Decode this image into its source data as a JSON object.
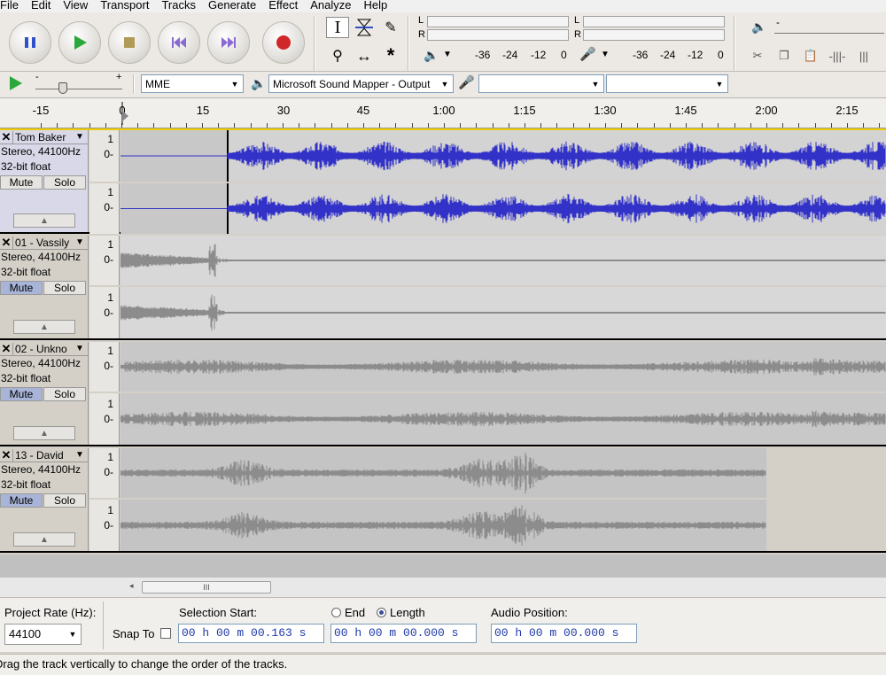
{
  "menu": [
    "File",
    "Edit",
    "View",
    "Transport",
    "Tracks",
    "Generate",
    "Effect",
    "Analyze",
    "Help"
  ],
  "transport": {
    "buttons": [
      {
        "name": "pause",
        "icon": "pause-icon"
      },
      {
        "name": "play",
        "icon": "play-icon"
      },
      {
        "name": "stop",
        "icon": "stop-icon"
      },
      {
        "name": "skip-start",
        "icon": "skip-start-icon"
      },
      {
        "name": "skip-end",
        "icon": "skip-end-icon"
      },
      {
        "name": "record",
        "icon": "record-icon"
      }
    ]
  },
  "meters": {
    "lr_labels": [
      "L",
      "R"
    ],
    "play_scale": [
      "-36",
      "-24",
      "-12",
      "0"
    ],
    "rec_scale": [
      "-36",
      "-24",
      "-12",
      "0"
    ]
  },
  "mixer": {
    "slider_minus": "-",
    "slider_plus": "+"
  },
  "device": {
    "host": "MME",
    "output": "Microsoft Sound Mapper - Output",
    "input": "",
    "channels": ""
  },
  "timeline": {
    "labels": [
      "-15",
      "0",
      "15",
      "30",
      "45",
      "1:00",
      "1:15",
      "1:30",
      "1:45",
      "2:00",
      "2:15"
    ]
  },
  "tracks": [
    {
      "name": "Tom Baker",
      "rate": "Stereo, 44100Hz",
      "format": "32-bit float",
      "mute": "Mute",
      "solo": "Solo",
      "mute_on": false,
      "selected": true,
      "scale_top": "1",
      "scale_mid": "0-"
    },
    {
      "name": "01 - Vassily",
      "rate": "Stereo, 44100Hz",
      "format": "32-bit float",
      "mute": "Mute",
      "solo": "Solo",
      "mute_on": true,
      "selected": false,
      "scale_top": "1",
      "scale_mid": "0-"
    },
    {
      "name": "02 - Unkno",
      "rate": "Stereo, 44100Hz",
      "format": "32-bit float",
      "mute": "Mute",
      "solo": "Solo",
      "mute_on": true,
      "selected": false,
      "scale_top": "1",
      "scale_mid": "0-"
    },
    {
      "name": "13 - David",
      "rate": "Stereo, 44100Hz",
      "format": "32-bit float",
      "mute": "Mute",
      "solo": "Solo",
      "mute_on": true,
      "selected": false,
      "scale_top": "1",
      "scale_mid": "0-"
    }
  ],
  "selection": {
    "project_rate_label": "Project Rate (Hz):",
    "project_rate": "44100",
    "snap_to": "Snap To",
    "selection_start_label": "Selection Start:",
    "end_label": "End",
    "length_label": "Length",
    "audio_position_label": "Audio Position:",
    "start_time": "00 h 00 m 00.163 s",
    "length_time": "00 h 00 m 00.000 s",
    "position_time": "00 h 00 m 00.000 s"
  },
  "status": "Drag the track vertically to change the order of the tracks.",
  "scroll_thumb": "III",
  "colors": {
    "wave_selected": "#3232c8",
    "wave_muted": "#8c8c8c",
    "mute_active": "#a9b5d8"
  }
}
